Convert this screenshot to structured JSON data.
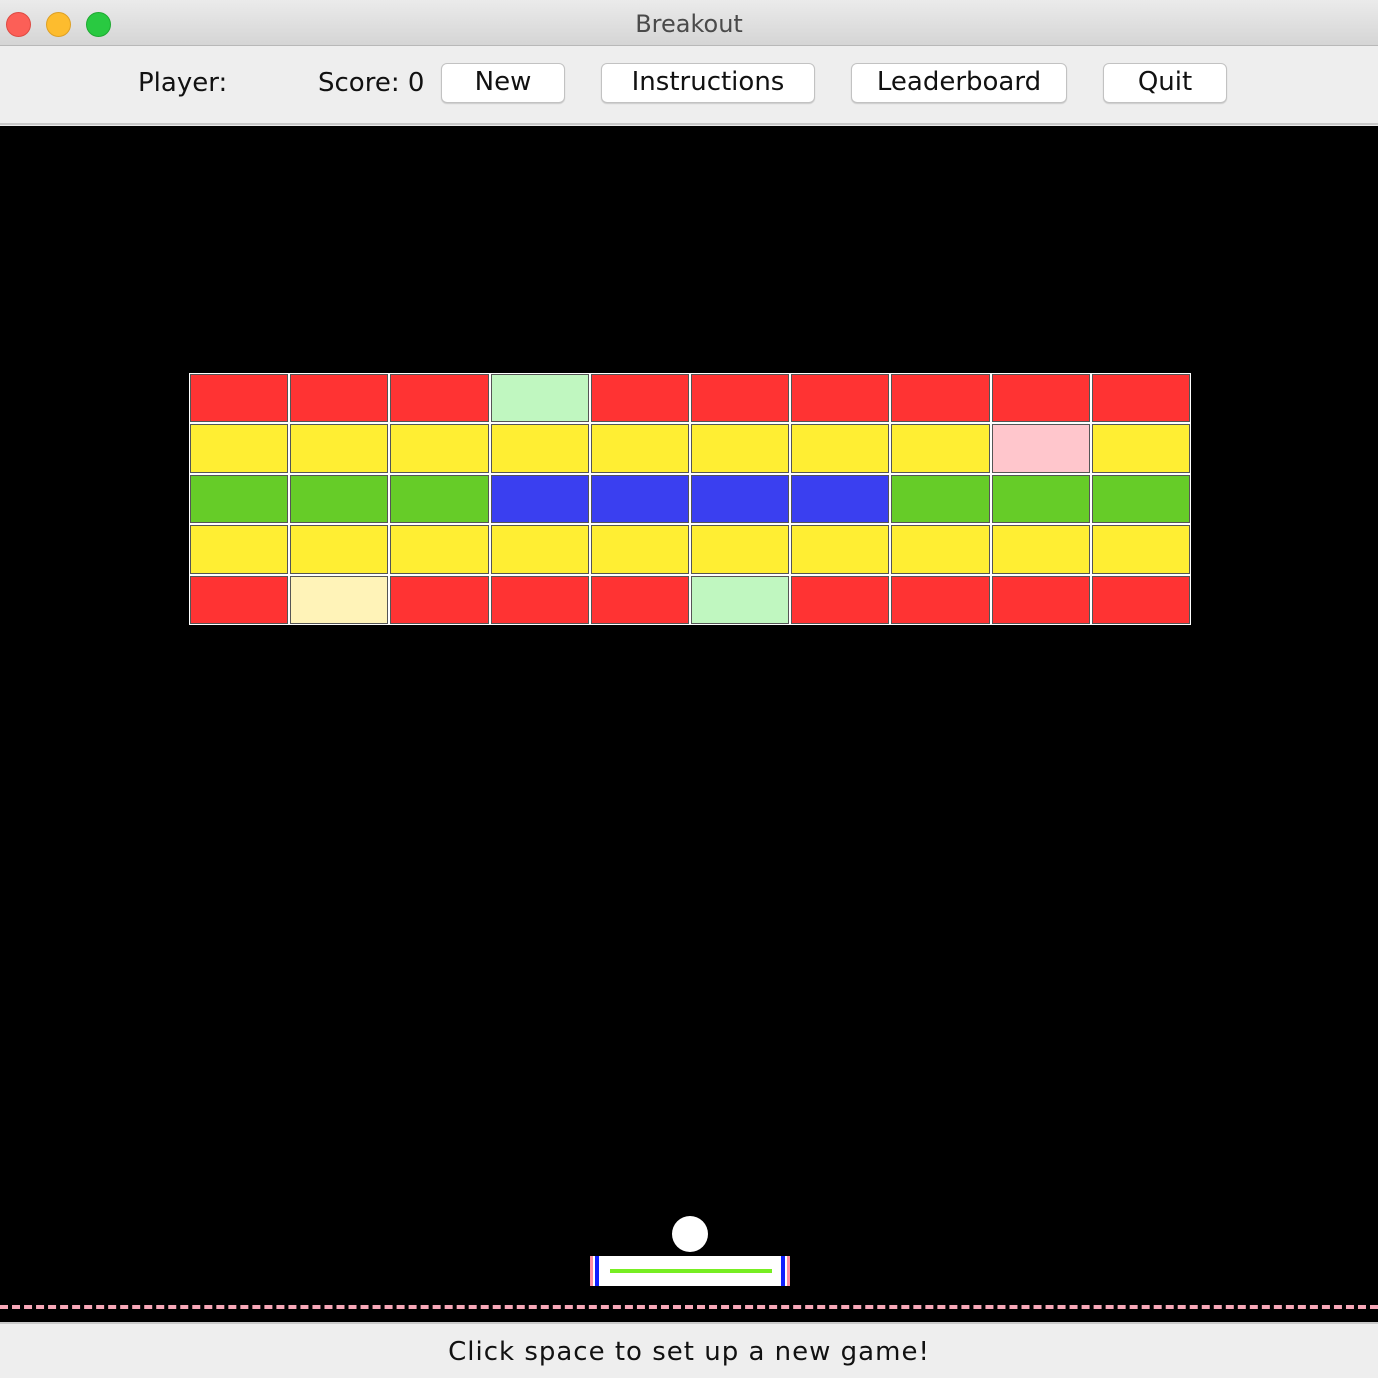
{
  "window": {
    "title": "Breakout"
  },
  "toolbar": {
    "player_label": "Player:",
    "score_label": "Score: 0",
    "new_label": "New",
    "instructions_label": "Instructions",
    "leaderboard_label": "Leaderboard",
    "quit_label": "Quit"
  },
  "colors": {
    "red": "#ff3333",
    "yellow": "#ffee33",
    "green": "#66cc28",
    "blue": "#3a3ff0",
    "light_green": "#c0f7c0",
    "pink": "#ffc6cc",
    "cream": "#fff3b8"
  },
  "bricks": [
    [
      "red",
      "red",
      "red",
      "light_green",
      "red",
      "red",
      "red",
      "red",
      "red",
      "red"
    ],
    [
      "yellow",
      "yellow",
      "yellow",
      "yellow",
      "yellow",
      "yellow",
      "yellow",
      "yellow",
      "pink",
      "yellow"
    ],
    [
      "green",
      "green",
      "green",
      "blue",
      "blue",
      "blue",
      "blue",
      "green",
      "green",
      "green"
    ],
    [
      "yellow",
      "yellow",
      "yellow",
      "yellow",
      "yellow",
      "yellow",
      "yellow",
      "yellow",
      "yellow",
      "yellow"
    ],
    [
      "red",
      "cream",
      "red",
      "red",
      "red",
      "light_green",
      "red",
      "red",
      "red",
      "red"
    ]
  ],
  "status": {
    "message": "Click space to set up a new game!"
  }
}
